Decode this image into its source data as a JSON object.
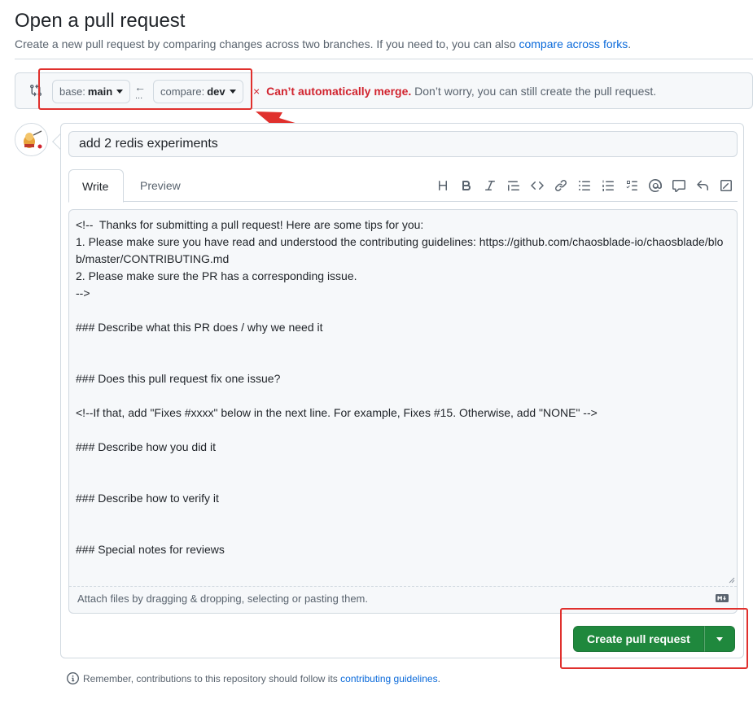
{
  "header": {
    "title": "Open a pull request",
    "subtitle_prefix": "Create a new pull request by comparing changes across two branches. If you need to, you can also",
    "subtitle_link": "compare across forks",
    "subtitle_suffix": "."
  },
  "compare": {
    "base_label": "base:",
    "base_value": "main",
    "compare_label": "compare:",
    "compare_value": "dev",
    "arrow": "←",
    "dots": "...",
    "status_icon": "×",
    "status_error": "Can’t automatically merge.",
    "status_message": "Don’t worry, you can still create the pull request."
  },
  "form": {
    "title_value": "add 2 redis experiments",
    "tabs": [
      {
        "label": "Write",
        "active": true
      },
      {
        "label": "Preview",
        "active": false
      }
    ],
    "toolbar_icons": [
      "heading-icon",
      "bold-icon",
      "italic-icon",
      "quote-icon",
      "code-icon",
      "link-icon",
      "unordered-list-icon",
      "ordered-list-icon",
      "task-list-icon",
      "mention-icon",
      "reference-icon",
      "reply-icon",
      "fullscreen-icon"
    ],
    "body_text": "<!--  Thanks for submitting a pull request! Here are some tips for you:\n1. Please make sure you have read and understood the contributing guidelines: https://github.com/chaosblade-io/chaosblade/blob/master/CONTRIBUTING.md\n2. Please make sure the PR has a corresponding issue.\n-->\n\n### Describe what this PR does / why we need it\n\n\n### Does this pull request fix one issue?\n\n<!--If that, add \"Fixes #xxxx\" below in the next line. For example, Fixes #15. Otherwise, add \"NONE\" -->\n\n### Describe how you did it\n\n\n### Describe how to verify it\n\n\n### Special notes for reviews",
    "attach_text": "Attach files by dragging & dropping, selecting or pasting them.",
    "create_button": "Create pull request"
  },
  "footer": {
    "prefix": "Remember, contributions to this repository should follow its",
    "link": "contributing guidelines",
    "suffix": "."
  },
  "colors": {
    "accent_link": "#0969da",
    "error": "#d1242f",
    "primary_button": "#1f883d",
    "annotation": "#e0302d"
  }
}
